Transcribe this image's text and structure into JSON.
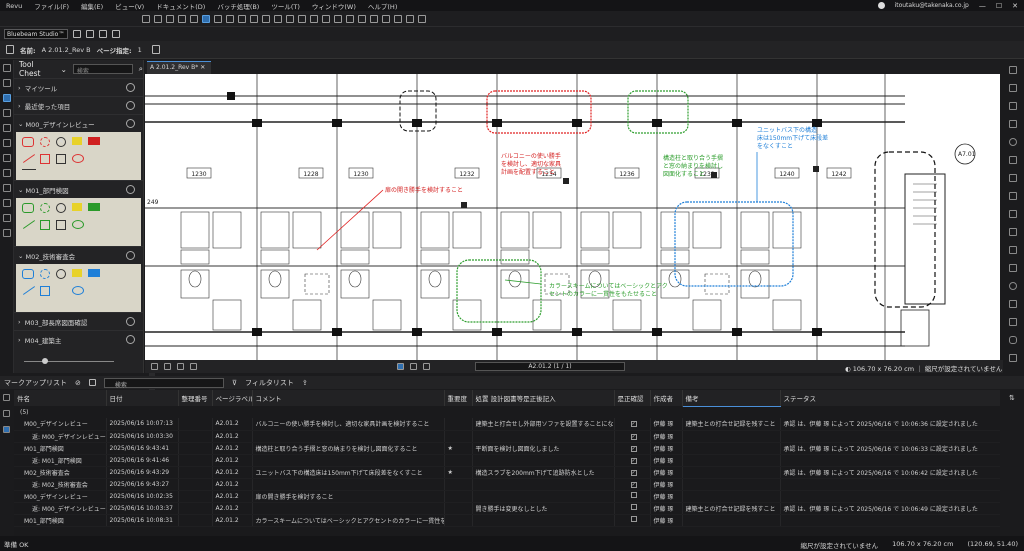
{
  "app": {
    "name": "Revu",
    "user": "itoutaku@takenaka.co.jp"
  },
  "menu": [
    "ファイル(F)",
    "編集(E)",
    "ビュー(V)",
    "ドキュメント(D)",
    "バッチ処理(B)",
    "ツール(T)",
    "ウィンドウ(W)",
    "ヘルプ(H)"
  ],
  "profile": "Bluebeam Studio™",
  "docbar": {
    "name_label": "名前:",
    "name_value": "A 2.01.2_Rev B",
    "page_label": "ページ指定:",
    "page_value": "1"
  },
  "tool_chest": {
    "title": "Tool Chest",
    "search_placeholder": "検索",
    "sections": [
      {
        "label": "マイツール",
        "expanded": false
      },
      {
        "label": "最近使った項目",
        "expanded": false
      },
      {
        "label": "M00_デザインレビュー",
        "expanded": true
      },
      {
        "label": "M01_部門検図",
        "expanded": true
      },
      {
        "label": "M02_技術審査会",
        "expanded": true
      },
      {
        "label": "M03_部長席図面確認",
        "expanded": false
      },
      {
        "label": "M04_建築主",
        "expanded": false
      }
    ]
  },
  "doc_tab": "A 2.01.2_Rev B*",
  "drawing": {
    "rooms": [
      "1230",
      "1228",
      "1230",
      "1232",
      "1234",
      "1236",
      "1238",
      "1240",
      "1242"
    ],
    "section_mark": "A7.01",
    "left_num": "249",
    "callouts": [
      {
        "text": "扉の開き勝手を検討すること",
        "color": "#d42020"
      },
      {
        "text": "バルコニーの使い勝手\nを検討し、適切な家具\n計画を配置すること",
        "color": "#d42020"
      },
      {
        "text": "構造柱と取り合う手摺\nと窓の納まりを検討し\n図面化すること",
        "color": "#2e9e2e"
      },
      {
        "text": "ユニットバス下の構造\n床は150mm下げて床段差\nをなくすこと",
        "color": "#1e7fd8"
      },
      {
        "text": "カラースキームについてはベーシックとアク\nセントのカラーに一貫性をもたせること",
        "color": "#2e9e2e"
      }
    ]
  },
  "navbar": {
    "page": "A2.01.2 (1 / 1)",
    "size": "106.70 x 76.20 cm",
    "scale": "縮尺が設定されていません"
  },
  "markup_list": {
    "title": "マークアップリスト",
    "search_placeholder": "検索",
    "filter": "フィルタリスト",
    "columns": [
      "件名",
      "日付",
      "整理番号",
      "ページラベル",
      "コメント",
      "重要度",
      "処置 設計図書等是正後記入",
      "是正確認",
      "作成者",
      "備考",
      "ステータス"
    ],
    "group": "(5)",
    "rows": [
      {
        "subject": "M00_デザインレビュー",
        "date": "2025/06/16 10:07:13",
        "page": "A2.01.2",
        "comment": "バルコニーの使い勝手を検討し、適切な家具計画を検討すること",
        "star": "",
        "action": "建築主と打合せし外部用ソファを設置することになった",
        "check": "✓",
        "author": "伊藤 琢",
        "note": "建築主との打合せ記録を残すこと",
        "status": "承認 は、伊藤 琢 によって 2025/06/16 で 10:06:36 に設定されました",
        "level": 1
      },
      {
        "subject": "返: M00_デザインレビュー",
        "date": "2025/06/16 10:03:30",
        "page": "A2.01.2",
        "comment": "",
        "star": "",
        "action": "",
        "check": "✓",
        "author": "伊藤 琢",
        "note": "",
        "status": "",
        "level": 2
      },
      {
        "subject": "M01_部門検図",
        "date": "2025/06/16 9:43:41",
        "page": "A2.01.2",
        "comment": "構造柱と取り合う手摺と窓の納まりを検討し図面化すること",
        "star": "★",
        "action": "平断面を検討し図面化しました",
        "check": "✓",
        "author": "伊藤 琢",
        "note": "",
        "status": "承認 は、伊藤 琢 によって 2025/06/16 で 10:06:33 に設定されました",
        "level": 1
      },
      {
        "subject": "返: M01_部門検図",
        "date": "2025/06/16 9:41:46",
        "page": "A2.01.2",
        "comment": "",
        "star": "",
        "action": "",
        "check": "✓",
        "author": "伊藤 琢",
        "note": "",
        "status": "",
        "level": 2
      },
      {
        "subject": "M02_技術審査会",
        "date": "2025/06/16 9:43:29",
        "page": "A2.01.2",
        "comment": "ユニットバス下の構造床は150mm下げて床段差をなくすこと",
        "star": "★",
        "action": "構造スラブを200mm下げて追跡防水とした",
        "check": "✓",
        "author": "伊藤 琢",
        "note": "",
        "status": "承認 は、伊藤 琢 によって 2025/06/16 で 10:06:42 に設定されました",
        "level": 1
      },
      {
        "subject": "返: M02_技術審査会",
        "date": "2025/06/16 9:43:27",
        "page": "A2.01.2",
        "comment": "",
        "star": "",
        "action": "",
        "check": "✓",
        "author": "伊藤 琢",
        "note": "",
        "status": "",
        "level": 2
      },
      {
        "subject": "M00_デザインレビュー",
        "date": "2025/06/16 10:02:35",
        "page": "A2.01.2",
        "comment": "扉の開き勝手を検討すること",
        "star": "",
        "action": "",
        "check": "",
        "author": "伊藤 琢",
        "note": "",
        "status": "",
        "level": 1
      },
      {
        "subject": "返: M00_デザインレビュー",
        "date": "2025/06/16 10:03:37",
        "page": "A2.01.2",
        "comment": "",
        "star": "",
        "action": "開き勝手は変更なしとした",
        "check": "",
        "author": "伊藤 琢",
        "note": "建築主との打合せ記録を残すこと",
        "status": "承認 は、伊藤 琢 によって 2025/06/16 で 10:06:49 に設定されました",
        "level": 2
      },
      {
        "subject": "M01_部門検図",
        "date": "2025/06/16 10:08:31",
        "page": "A2.01.2",
        "comment": "カラースキームについてはベーシックとアクセントのカラーに一貫性をもたせること",
        "star": "",
        "action": "",
        "check": "",
        "author": "伊藤 琢",
        "note": "",
        "status": "",
        "level": 1
      }
    ]
  },
  "status_bar": {
    "left": "準備 OK",
    "scale": "縮尺が設定されていません",
    "size": "106.70 x 76.20 cm",
    "coords": "(120.69, 51.40)"
  }
}
